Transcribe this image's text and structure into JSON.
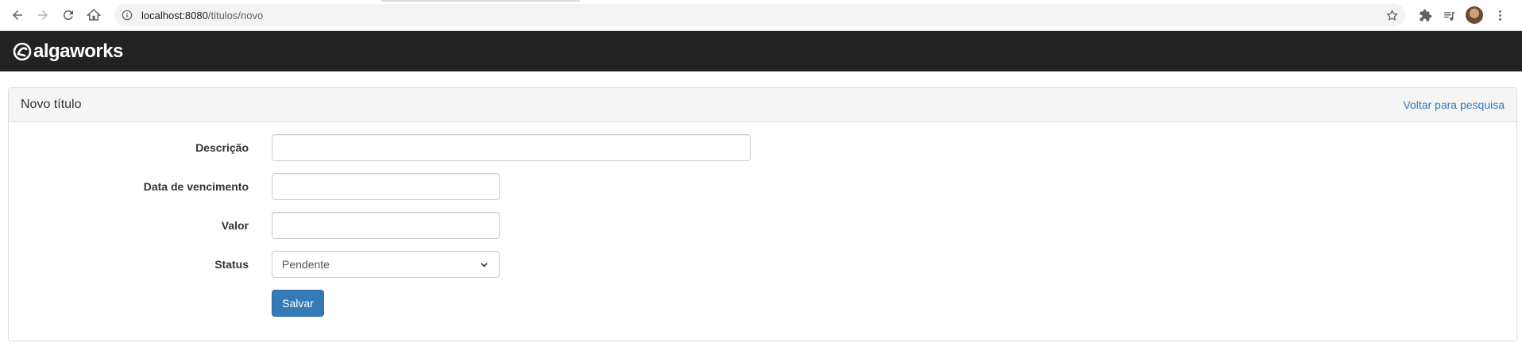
{
  "browser": {
    "url_host": "localhost:8080",
    "url_path": "/titulos/novo"
  },
  "app": {
    "brand": "algaworks"
  },
  "panel": {
    "title": "Novo título",
    "back_link": "Voltar para pesquisa"
  },
  "form": {
    "descricao_label": "Descrição",
    "descricao_value": "",
    "vencimento_label": "Data de vencimento",
    "vencimento_value": "",
    "valor_label": "Valor",
    "valor_value": "",
    "status_label": "Status",
    "status_selected": "Pendente",
    "save_label": "Salvar"
  },
  "colors": {
    "navbar_bg": "#222222",
    "primary": "#337ab7",
    "link": "#337ab7"
  }
}
